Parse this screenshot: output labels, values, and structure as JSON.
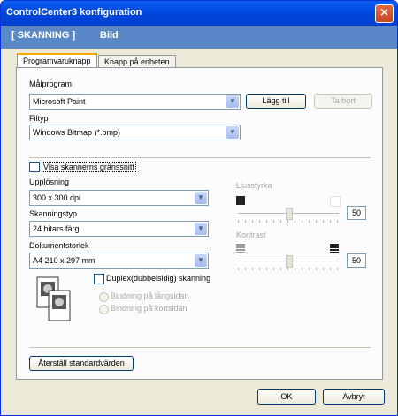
{
  "window": {
    "title": "ControlCenter3 konfiguration",
    "close_glyph": "×"
  },
  "header": {
    "section": "[  SKANNING  ]",
    "subsection": "Bild"
  },
  "tabs": [
    {
      "label": "Programvaruknapp",
      "active": true
    },
    {
      "label": "Knapp på enheten",
      "active": false
    }
  ],
  "target": {
    "label": "Målprogram",
    "value": "Microsoft Paint",
    "add_button": "Lägg till",
    "remove_button": "Ta bort"
  },
  "filetype": {
    "label": "Filtyp",
    "value": "Windows Bitmap (*.bmp)"
  },
  "show_scanner_ui": {
    "label": "Visa skannerns gränssnitt",
    "checked": false
  },
  "resolution": {
    "label": "Upplösning",
    "value": "300 x 300 dpi"
  },
  "scan_type": {
    "label": "Skanningstyp",
    "value": "24 bitars färg"
  },
  "doc_size": {
    "label": "Dokumentstorlek",
    "value": "A4 210 x 297 mm"
  },
  "brightness": {
    "label": "Ljusstyrka",
    "value": "50",
    "level": 0.5
  },
  "contrast": {
    "label": "Kontrast",
    "value": "50",
    "level": 0.5
  },
  "duplex": {
    "label": "Duplex(dubbelsidig) skanning",
    "checked": false,
    "options": [
      "Bindning på långsidan",
      "Bindning på kortsidan"
    ]
  },
  "restore_button": "Återställ standardvärden",
  "ok_button": "OK",
  "cancel_button": "Avbryt",
  "colors": {
    "title_bar": "#0046dd",
    "header_band": "#5a87c5",
    "dialog_bg": "#ece9d8"
  },
  "icons": [
    "close-icon",
    "dropdown-arrow-icon",
    "brightness-dark-icon",
    "brightness-light-icon",
    "contrast-low-icon",
    "contrast-high-icon",
    "duplex-pages-icon"
  ]
}
